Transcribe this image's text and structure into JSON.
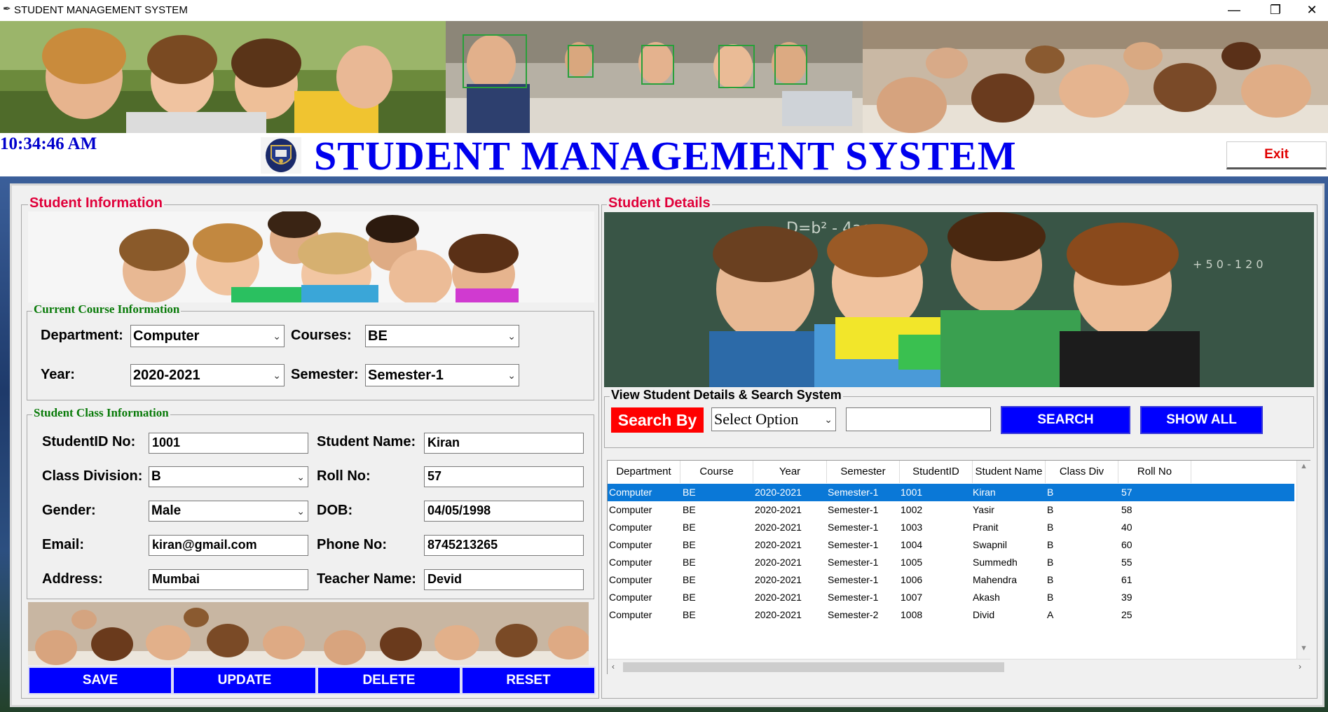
{
  "window": {
    "title": "STUDENT MANAGEMENT SYSTEM",
    "buttons": {
      "minimize": "—",
      "restore": "❐",
      "close": "✕"
    }
  },
  "header": {
    "clock": "10:34:46 AM",
    "title": "STUDENT MANAGEMENT SYSTEM",
    "exit_label": "Exit"
  },
  "student_info": {
    "group_label": "Student Information",
    "course_group_label": "Current Course Information",
    "class_group_label": "Student Class Information",
    "department": {
      "label": "Department:",
      "value": "Computer"
    },
    "courses": {
      "label": "Courses:",
      "value": "BE"
    },
    "year": {
      "label": "Year:",
      "value": "2020-2021"
    },
    "semester": {
      "label": "Semester:",
      "value": "Semester-1"
    },
    "student_id": {
      "label": "StudentID No:",
      "value": "1001"
    },
    "student_name": {
      "label": "Student Name:",
      "value": "Kiran"
    },
    "class_division": {
      "label": "Class Division:",
      "value": "B"
    },
    "roll_no": {
      "label": "Roll No:",
      "value": "57"
    },
    "gender": {
      "label": "Gender:",
      "value": "Male"
    },
    "dob": {
      "label": "DOB:",
      "value": "04/05/1998"
    },
    "email": {
      "label": "Email:",
      "value": "kiran@gmail.com"
    },
    "phone": {
      "label": "Phone No:",
      "value": "8745213265"
    },
    "address": {
      "label": "Address:",
      "value": "Mumbai"
    },
    "teacher": {
      "label": "Teacher Name:",
      "value": "Devid"
    },
    "buttons": {
      "save": "SAVE",
      "update": "UPDATE",
      "delete": "DELETE",
      "reset": "RESET"
    }
  },
  "student_details": {
    "group_label": "Student Details",
    "search_group_label": "View Student Details & Search System",
    "search_by_label": "Search By",
    "search_option": "Select Option",
    "search_text": "",
    "search_button": "SEARCH",
    "show_all_button": "SHOW ALL"
  },
  "table": {
    "columns": [
      "Department",
      "Course",
      "Year",
      "Semester",
      "StudentID",
      "Student Name",
      "Class Div",
      "Roll No"
    ],
    "rows": [
      [
        "Computer",
        "BE",
        "2020-2021",
        "Semester-1",
        "1001",
        "Kiran",
        "B",
        "57"
      ],
      [
        "Computer",
        "BE",
        "2020-2021",
        "Semester-1",
        "1002",
        "Yasir",
        "B",
        "58"
      ],
      [
        "Computer",
        "BE",
        "2020-2021",
        "Semester-1",
        "1003",
        "Pranit",
        "B",
        "40"
      ],
      [
        "Computer",
        "BE",
        "2020-2021",
        "Semester-1",
        "1004",
        "Swapnil",
        "B",
        "60"
      ],
      [
        "Computer",
        "BE",
        "2020-2021",
        "Semester-1",
        "1005",
        "Summedh",
        "B",
        "55"
      ],
      [
        "Computer",
        "BE",
        "2020-2021",
        "Semester-1",
        "1006",
        "Mahendra",
        "B",
        "61"
      ],
      [
        "Computer",
        "BE",
        "2020-2021",
        "Semester-1",
        "1007",
        "Akash",
        "B",
        "39"
      ],
      [
        "Computer",
        "BE",
        "2020-2021",
        "Semester-2",
        "1008",
        "Divid",
        "A",
        "25"
      ]
    ],
    "selected_row": 0
  },
  "colors": {
    "accent_blue": "#0000ff",
    "title_blue": "#0000ee",
    "label_red": "#e0003a",
    "label_green": "#087a08",
    "selection": "#0a78d7"
  }
}
